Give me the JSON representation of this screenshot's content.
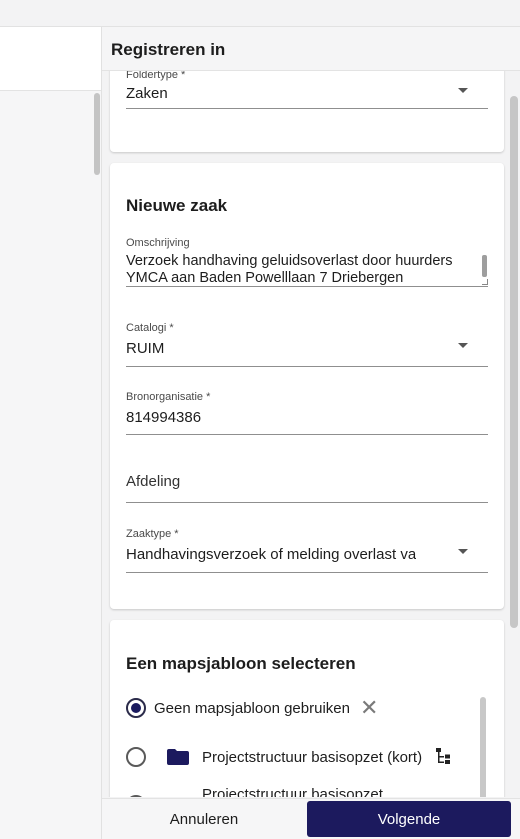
{
  "panel": {
    "title": "Registreren in"
  },
  "folder": {
    "type_label": "Foldertype *",
    "type_value": "Zaken"
  },
  "new_case": {
    "heading": "Nieuwe zaak",
    "description_label": "Omschrijving",
    "description_line1": "Verzoek handhaving geluidsoverlast door huurders",
    "description_line2": "YMCA aan Baden Powelllaan 7 Driebergen",
    "catalog_label": "Catalogi *",
    "catalog_value": "RUIM",
    "source_org_label": "Bronorganisatie *",
    "source_org_value": "814994386",
    "department_placeholder": "Afdeling",
    "case_type_label": "Zaaktype *",
    "case_type_value": "Handhavingsverzoek of melding overlast var"
  },
  "template_select": {
    "heading": "Een mapsjabloon selecteren",
    "options": [
      {
        "label": "Geen mapsjabloon gebruiken",
        "selected": true,
        "icon": "close-icon"
      },
      {
        "label": "Projectstructuur basisopzet (kort)",
        "selected": false,
        "icon": "folder-icon"
      },
      {
        "label": "Projectstructuur basisopzet",
        "selected": false,
        "icon": "folder-icon"
      }
    ]
  },
  "footer": {
    "cancel_label": "Annuleren",
    "next_label": "Volgende"
  },
  "colors": {
    "primary": "#1c1a5e",
    "folder": "#1c1a5e"
  }
}
